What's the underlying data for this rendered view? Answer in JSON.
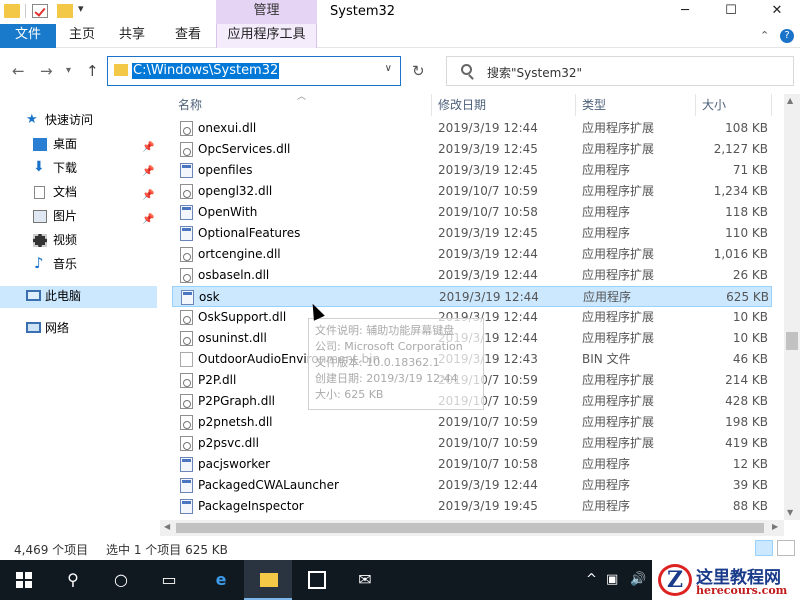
{
  "window": {
    "title": "System32",
    "context_group": "管理",
    "minimize": "─",
    "maximize": "☐",
    "close": "✕"
  },
  "ribbon": {
    "file": "文件",
    "home": "主页",
    "share": "共享",
    "view": "查看",
    "app_tools": "应用程序工具"
  },
  "address": {
    "path": "C:\\Windows\\System32",
    "search_placeholder": "搜索\"System32\""
  },
  "nav": {
    "quick_access": "快速访问",
    "items": [
      {
        "label": "桌面",
        "icon": "desktop-icon"
      },
      {
        "label": "下载",
        "icon": "download-icon"
      },
      {
        "label": "文档",
        "icon": "document-icon"
      },
      {
        "label": "图片",
        "icon": "picture-icon"
      },
      {
        "label": "视频",
        "icon": "video-icon"
      },
      {
        "label": "音乐",
        "icon": "music-icon"
      }
    ],
    "this_pc": "此电脑",
    "network": "网络"
  },
  "columns": {
    "name": "名称",
    "date": "修改日期",
    "type": "类型",
    "size": "大小"
  },
  "files": [
    {
      "name": "onexui.dll",
      "date": "2019/3/19 12:44",
      "type": "应用程序扩展",
      "size": "108 KB",
      "kind": "dll"
    },
    {
      "name": "OpcServices.dll",
      "date": "2019/3/19 12:45",
      "type": "应用程序扩展",
      "size": "2,127 KB",
      "kind": "dll"
    },
    {
      "name": "openfiles",
      "date": "2019/3/19 12:45",
      "type": "应用程序",
      "size": "71 KB",
      "kind": "exe"
    },
    {
      "name": "opengl32.dll",
      "date": "2019/10/7 10:59",
      "type": "应用程序扩展",
      "size": "1,234 KB",
      "kind": "dll"
    },
    {
      "name": "OpenWith",
      "date": "2019/10/7 10:58",
      "type": "应用程序",
      "size": "118 KB",
      "kind": "exe"
    },
    {
      "name": "OptionalFeatures",
      "date": "2019/3/19 12:45",
      "type": "应用程序",
      "size": "110 KB",
      "kind": "exe"
    },
    {
      "name": "ortcengine.dll",
      "date": "2019/3/19 12:44",
      "type": "应用程序扩展",
      "size": "1,016 KB",
      "kind": "dll"
    },
    {
      "name": "osbaseln.dll",
      "date": "2019/3/19 12:44",
      "type": "应用程序扩展",
      "size": "26 KB",
      "kind": "dll"
    },
    {
      "name": "osk",
      "date": "2019/3/19 12:44",
      "type": "应用程序",
      "size": "625 KB",
      "kind": "exe",
      "selected": true
    },
    {
      "name": "OskSupport.dll",
      "date": "2019/3/19 12:44",
      "type": "应用程序扩展",
      "size": "10 KB",
      "kind": "dll"
    },
    {
      "name": "osuninst.dll",
      "date": "2019/3/19 12:44",
      "type": "应用程序扩展",
      "size": "10 KB",
      "kind": "dll"
    },
    {
      "name": "OutdoorAudioEnvironment.bin",
      "date": "2019/3/19 12:43",
      "type": "BIN 文件",
      "size": "46 KB",
      "kind": "bin"
    },
    {
      "name": "P2P.dll",
      "date": "2019/10/7 10:59",
      "type": "应用程序扩展",
      "size": "214 KB",
      "kind": "dll"
    },
    {
      "name": "P2PGraph.dll",
      "date": "2019/10/7 10:59",
      "type": "应用程序扩展",
      "size": "428 KB",
      "kind": "dll"
    },
    {
      "name": "p2pnetsh.dll",
      "date": "2019/10/7 10:59",
      "type": "应用程序扩展",
      "size": "198 KB",
      "kind": "dll"
    },
    {
      "name": "p2psvc.dll",
      "date": "2019/10/7 10:59",
      "type": "应用程序扩展",
      "size": "419 KB",
      "kind": "dll"
    },
    {
      "name": "pacjsworker",
      "date": "2019/10/7 10:58",
      "type": "应用程序",
      "size": "12 KB",
      "kind": "exe"
    },
    {
      "name": "PackagedCWALauncher",
      "date": "2019/3/19 12:44",
      "type": "应用程序",
      "size": "39 KB",
      "kind": "exe"
    },
    {
      "name": "PackageInspector",
      "date": "2019/3/19 19:45",
      "type": "应用程序",
      "size": "88 KB",
      "kind": "exe"
    }
  ],
  "tooltip": {
    "description": "文件说明: 辅助功能屏幕键盘",
    "company": "公司: Microsoft Corporation",
    "version": "文件版本: 10.0.18362.1",
    "created": "创建日期: 2019/3/19 12:44",
    "size": "大小: 625 KB"
  },
  "status": {
    "count": "4,469 个项目",
    "selected": "选中 1 个项目  625 KB"
  },
  "watermark": {
    "title": "这里教程网",
    "url": "herecours.com",
    "logo_letter": "Z"
  }
}
